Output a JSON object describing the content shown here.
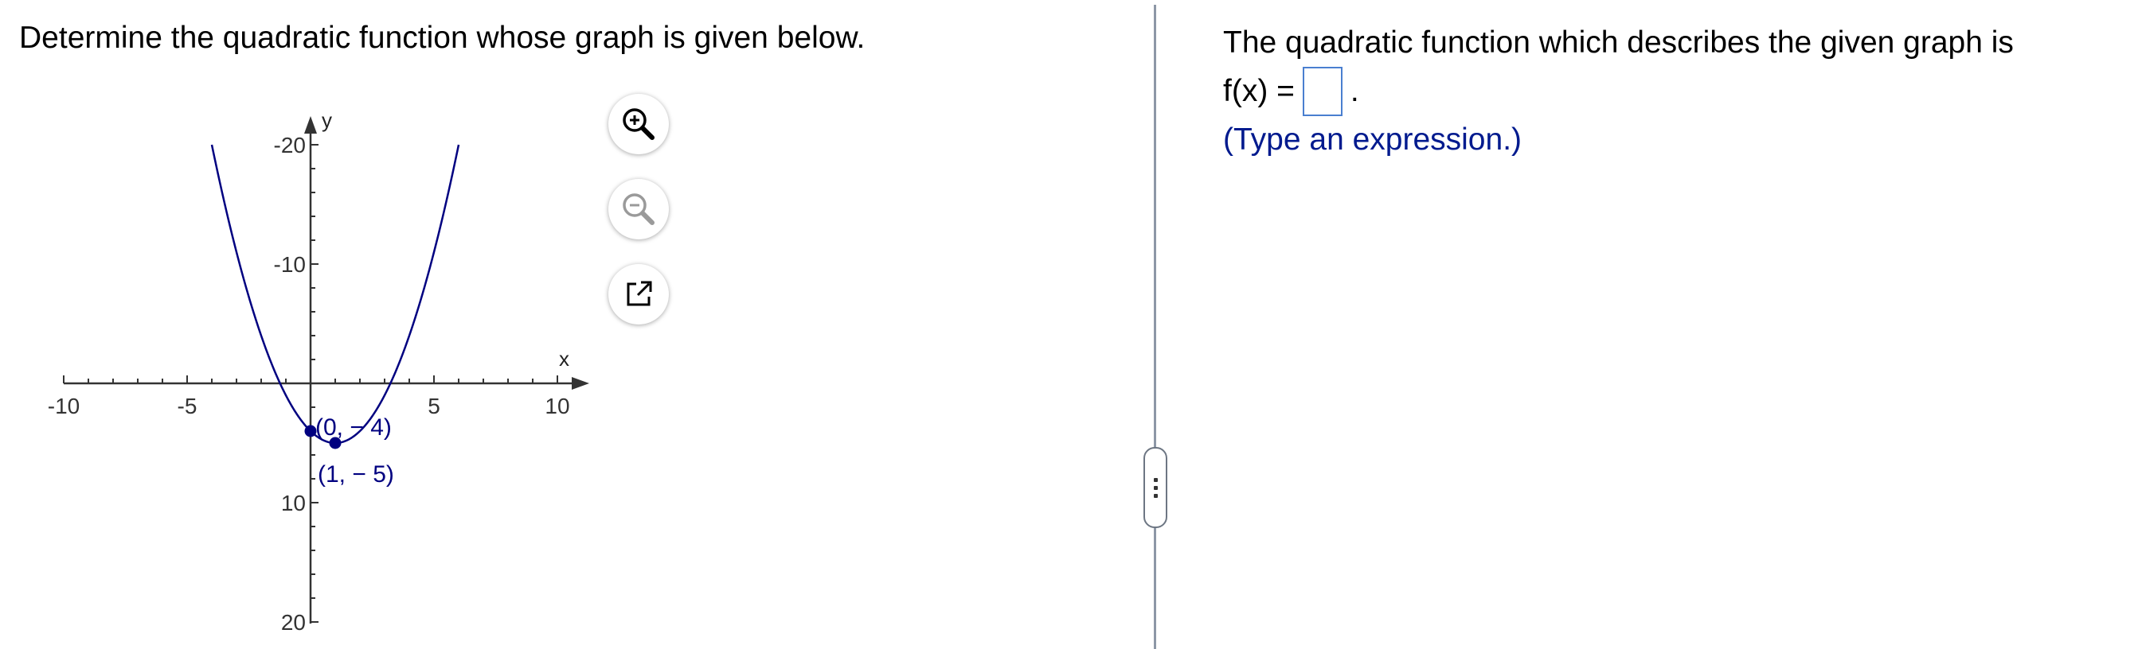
{
  "question": {
    "prompt": "Determine the quadratic function whose graph is given below."
  },
  "graph": {
    "x_axis_label": "x",
    "y_axis_label": "y",
    "x_tick_labels": [
      "-10",
      "-5",
      "5",
      "10"
    ],
    "y_tick_labels": [
      "20",
      "10",
      "-10",
      "-20"
    ],
    "point_labels": [
      "(0, − 4)",
      "(1, − 5)"
    ],
    "colors": {
      "curve": "#000080",
      "axis": "#333333"
    }
  },
  "chart_data": {
    "type": "line",
    "title": "",
    "xlabel": "x",
    "ylabel": "y",
    "xlim": [
      -10,
      10
    ],
    "ylim": [
      -20,
      20
    ],
    "x_ticks": [
      -10,
      -5,
      5,
      10
    ],
    "y_ticks": [
      -20,
      -10,
      10,
      20
    ],
    "series": [
      {
        "function": "x^2 - 2x - 4",
        "x_range": [
          -4,
          6
        ]
      }
    ],
    "points": [
      {
        "x": 0,
        "y": -4,
        "label": "(0, − 4)"
      },
      {
        "x": 1,
        "y": -5,
        "label": "(1, − 5)"
      }
    ]
  },
  "tools": {
    "zoom_in": "zoom-in-icon",
    "zoom_out": "zoom-out-icon",
    "popout": "popout-icon"
  },
  "answer": {
    "intro": "The quadratic function which describes the given graph is",
    "fx_label": "f(x) =",
    "period": ".",
    "hint": "(Type an expression.)"
  }
}
